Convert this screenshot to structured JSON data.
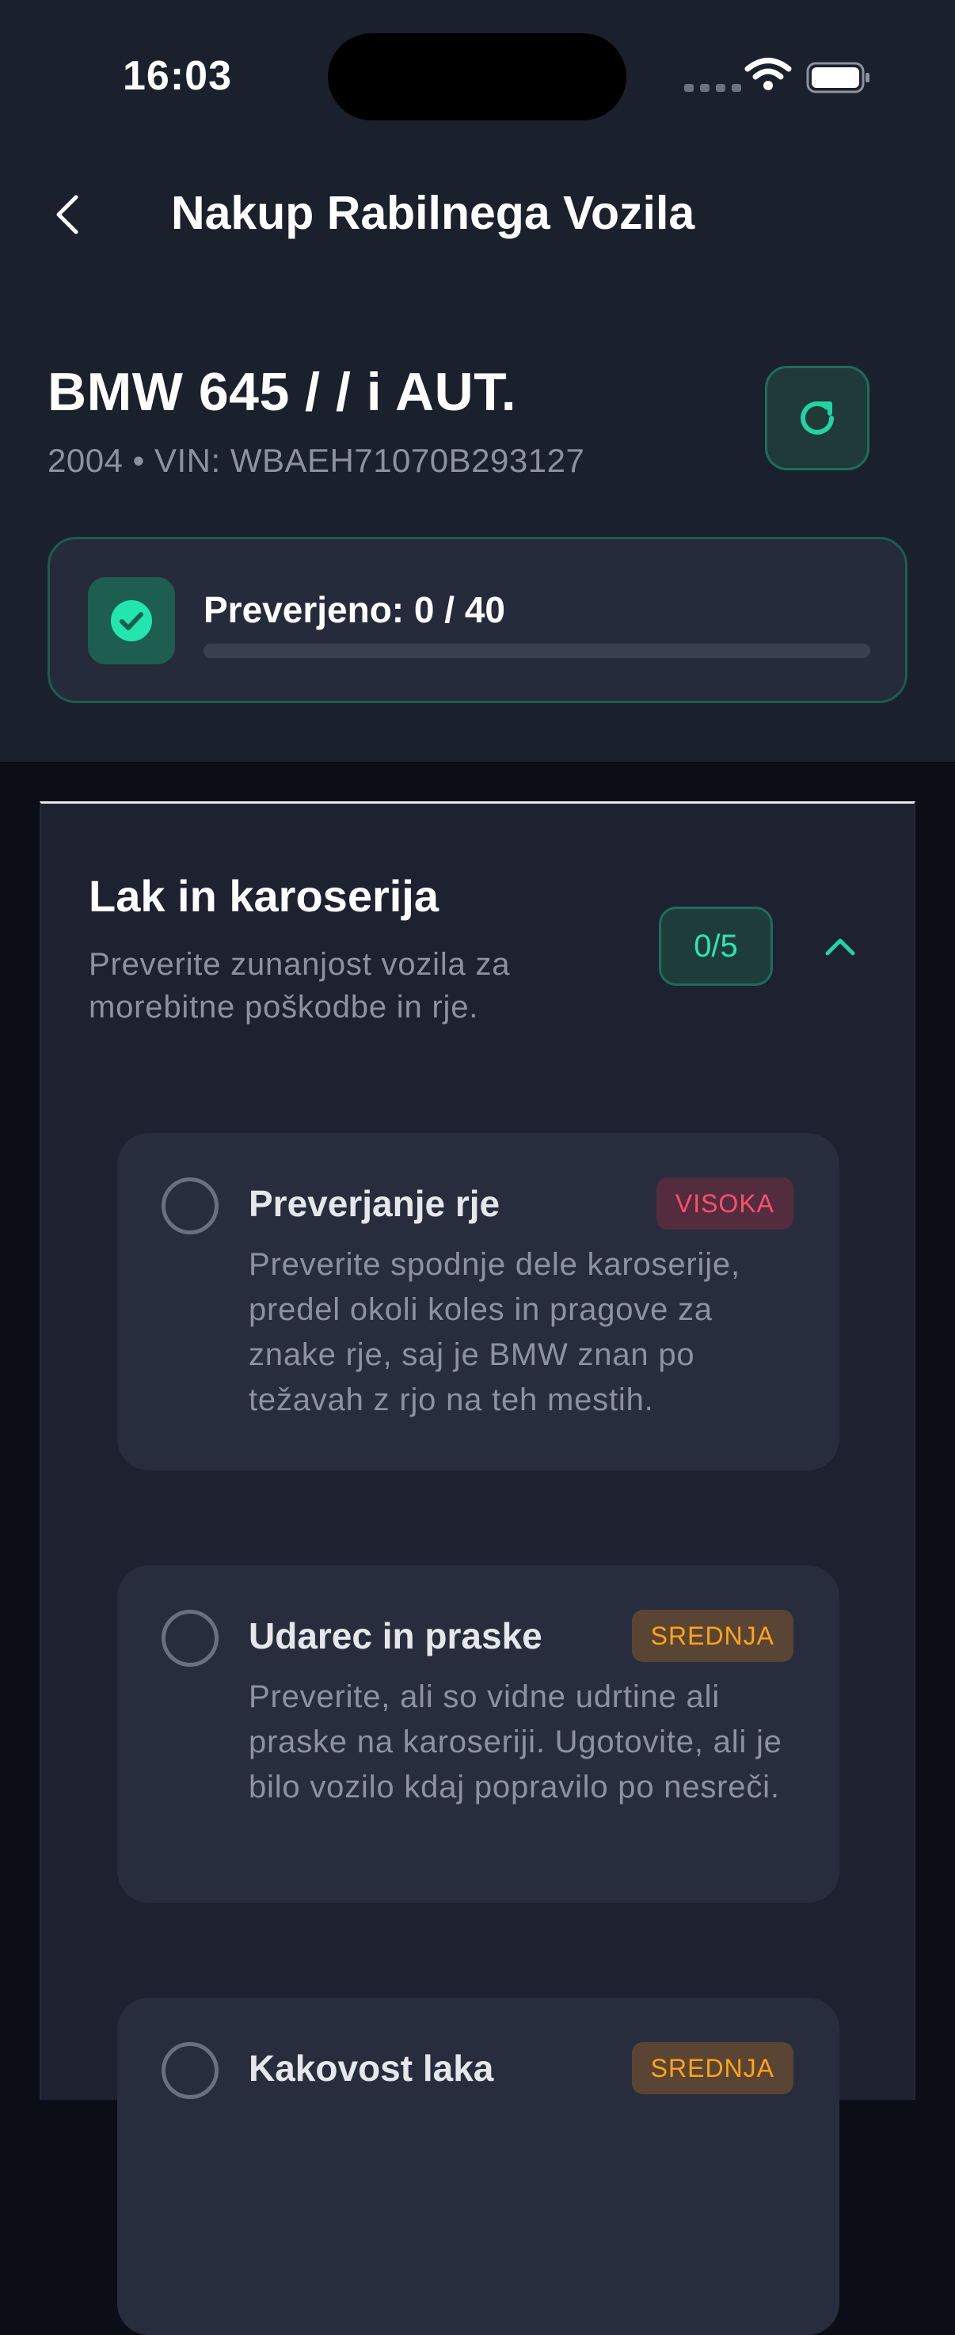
{
  "status_bar": {
    "time": "16:03"
  },
  "nav": {
    "title": "Nakup Rabilnega Vozila"
  },
  "vehicle": {
    "title": "BMW 645 / / i AUT.",
    "subtitle": "2004 • VIN: WBAEH71070B293127"
  },
  "progress": {
    "label": "Preverjeno: 0 / 40",
    "checked": 0,
    "total": 40,
    "fill_fraction": 0
  },
  "section": {
    "title": "Lak in karoserija",
    "description": "Preverite zunanjost vozila za morebitne poškodbe in rje.",
    "count": "0/5",
    "items": [
      {
        "title": "Preverjanje rje",
        "badge": "VISOKA",
        "description": "Preverite spodnje dele karoserije, predel okoli koles in pragove za znake rje, saj je BMW znan po težavah z rjo na teh mestih."
      },
      {
        "title": "Udarec in praske",
        "badge": "SREDNJA",
        "description": "Preverite, ali so vidne udrtine ali praske na karoseriji. Ugotovite, ali je bilo vozilo kdaj popravilo po nesreči."
      },
      {
        "title": "Kakovost laka",
        "badge": "SREDNJA",
        "description": ""
      }
    ]
  },
  "colors": {
    "accent": "#22d3a5",
    "header_bg": "#1b202d",
    "page_bg": "#0b0e17",
    "badge_high": "#ff4f6d",
    "badge_medium": "#ffa31a"
  },
  "icons": {
    "back": "chevron-left-icon",
    "refresh": "refresh-icon",
    "progress": "check-circle-icon",
    "collapse": "chevron-up-icon"
  }
}
